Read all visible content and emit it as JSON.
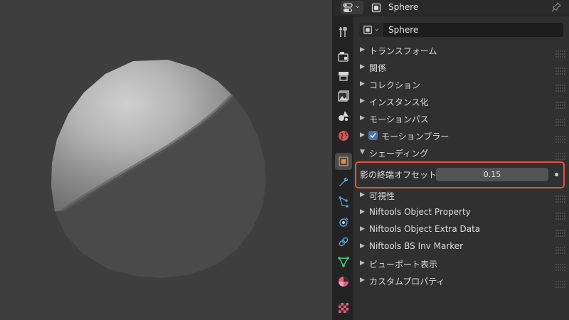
{
  "header": {
    "title": "Sphere",
    "editor_icon": "properties-editor-icon",
    "object_icon": "object-icon",
    "pin_icon": "pin-icon"
  },
  "object_selector": {
    "value": "Sphere",
    "icon": "object-icon"
  },
  "tabs": [
    {
      "name": "tool",
      "icon": "tool-icon"
    },
    {
      "name": "render",
      "icon": "render-icon"
    },
    {
      "name": "output",
      "icon": "output-icon"
    },
    {
      "name": "view-layer",
      "icon": "view-layer-icon"
    },
    {
      "name": "scene",
      "icon": "scene-icon"
    },
    {
      "name": "world",
      "icon": "world-icon"
    },
    {
      "name": "object",
      "icon": "object-icon",
      "active": true
    },
    {
      "name": "modifiers",
      "icon": "wrench-icon"
    },
    {
      "name": "particles",
      "icon": "particles-icon"
    },
    {
      "name": "physics",
      "icon": "physics-icon"
    },
    {
      "name": "constraints",
      "icon": "constraints-icon"
    },
    {
      "name": "data",
      "icon": "mesh-data-icon"
    },
    {
      "name": "material",
      "icon": "material-icon"
    },
    {
      "name": "texture",
      "icon": "texture-icon"
    }
  ],
  "sections": [
    {
      "label": "トランスフォーム",
      "expanded": false
    },
    {
      "label": "関係",
      "expanded": false
    },
    {
      "label": "コレクション",
      "expanded": false
    },
    {
      "label": "インスタンス化",
      "expanded": false
    },
    {
      "label": "モーションパス",
      "expanded": false
    },
    {
      "label": "モーションブラー",
      "expanded": false,
      "checkbox": true
    },
    {
      "label": "シェーディング",
      "expanded": true
    },
    {
      "label": "可視性",
      "expanded": false
    },
    {
      "label": "Niftools Object Property",
      "expanded": false
    },
    {
      "label": "Niftools Object Extra Data",
      "expanded": false
    },
    {
      "label": "Niftools BS Inv Marker",
      "expanded": false
    },
    {
      "label": "ビューポート表示",
      "expanded": false
    },
    {
      "label": "カスタムプロパティ",
      "expanded": false
    }
  ],
  "shading": {
    "shadow_terminator_label": "影の終端オフセット",
    "shadow_terminator_value": "0.15"
  },
  "colors": {
    "highlight": "#e8523a",
    "checkbox": "#4772b3",
    "object_tab": "#e8953a"
  }
}
